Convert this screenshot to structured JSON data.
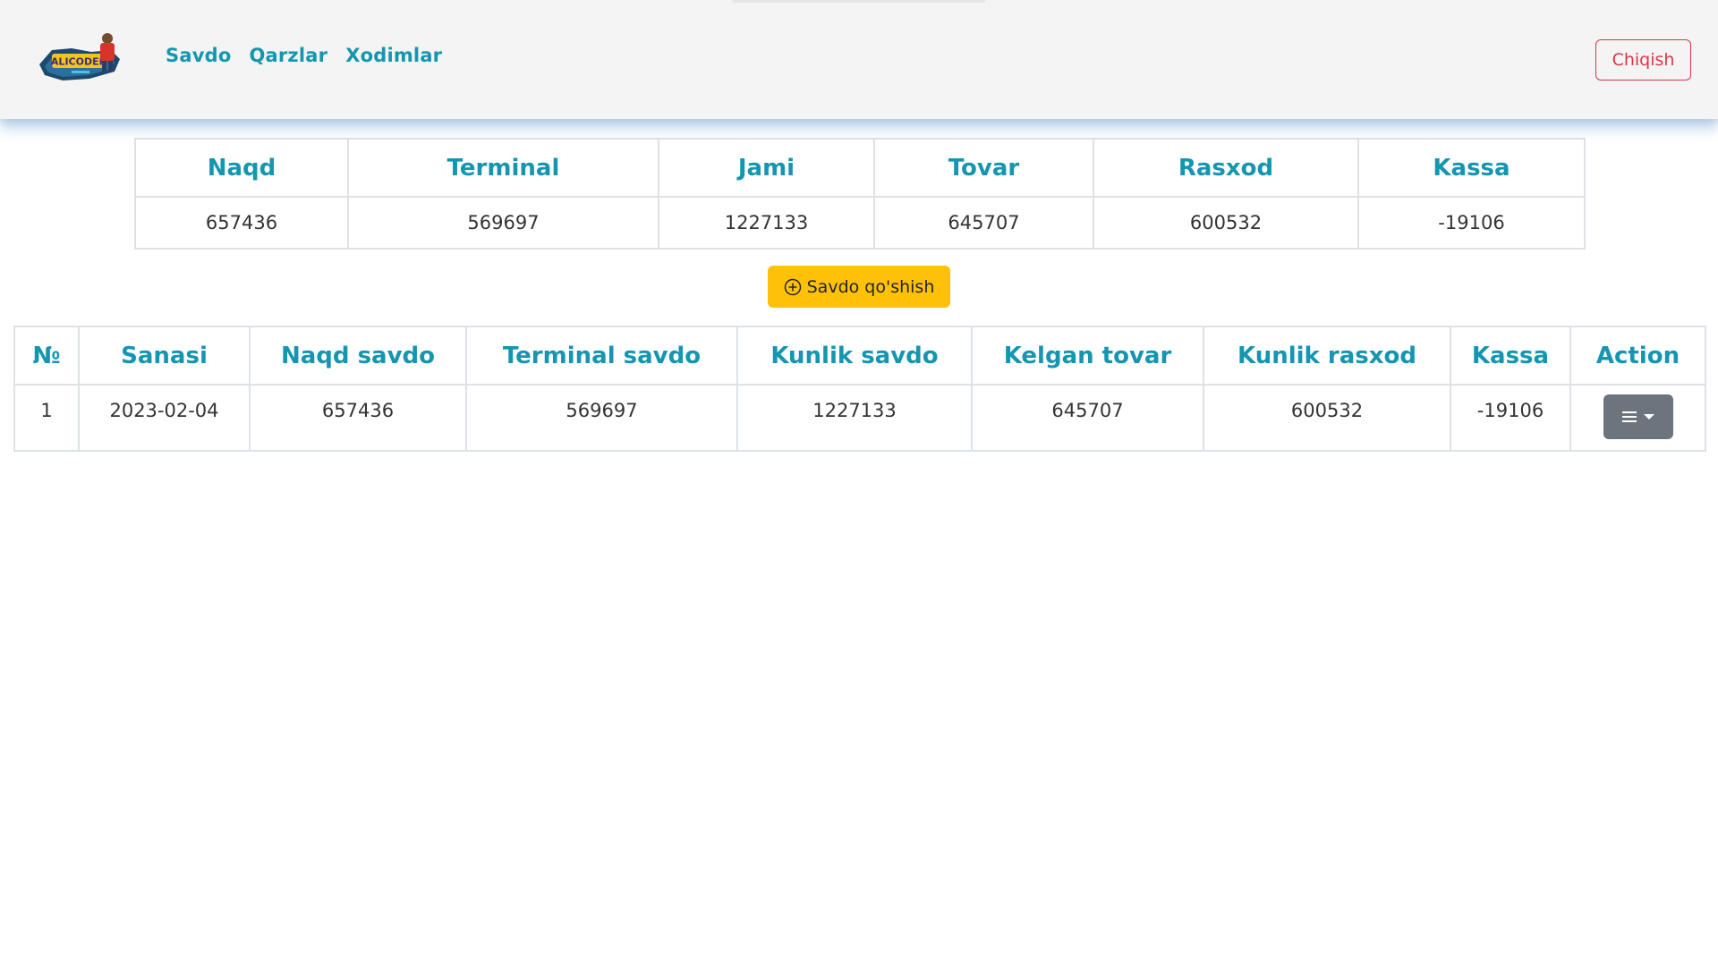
{
  "nav": {
    "links": [
      "Savdo",
      "Qarzlar",
      "Xodimlar"
    ],
    "logout_label": "Chiqish",
    "logo_text": "ALICODER",
    "accent_color": "#1596b0",
    "danger_color": "#dc3545"
  },
  "summary": {
    "headers": [
      "Naqd",
      "Terminal",
      "Jami",
      "Tovar",
      "Rasxod",
      "Kassa"
    ],
    "values": [
      "657436",
      "569697",
      "1227133",
      "645707",
      "600532",
      "-19106"
    ]
  },
  "add_button": {
    "label": "Savdo qo'shish",
    "icon": "plus-circle-icon",
    "color": "#ffc107"
  },
  "table": {
    "headers": [
      "№",
      "Sanasi",
      "Naqd savdo",
      "Terminal savdo",
      "Kunlik savdo",
      "Kelgan tovar",
      "Kunlik rasxod",
      "Kassa",
      "Action"
    ],
    "rows": [
      [
        "1",
        "2023-02-04",
        "657436",
        "569697",
        "1227133",
        "645707",
        "600532",
        "-19106"
      ]
    ],
    "action_icons": [
      "menu-icon",
      "caret-down-icon"
    ]
  }
}
